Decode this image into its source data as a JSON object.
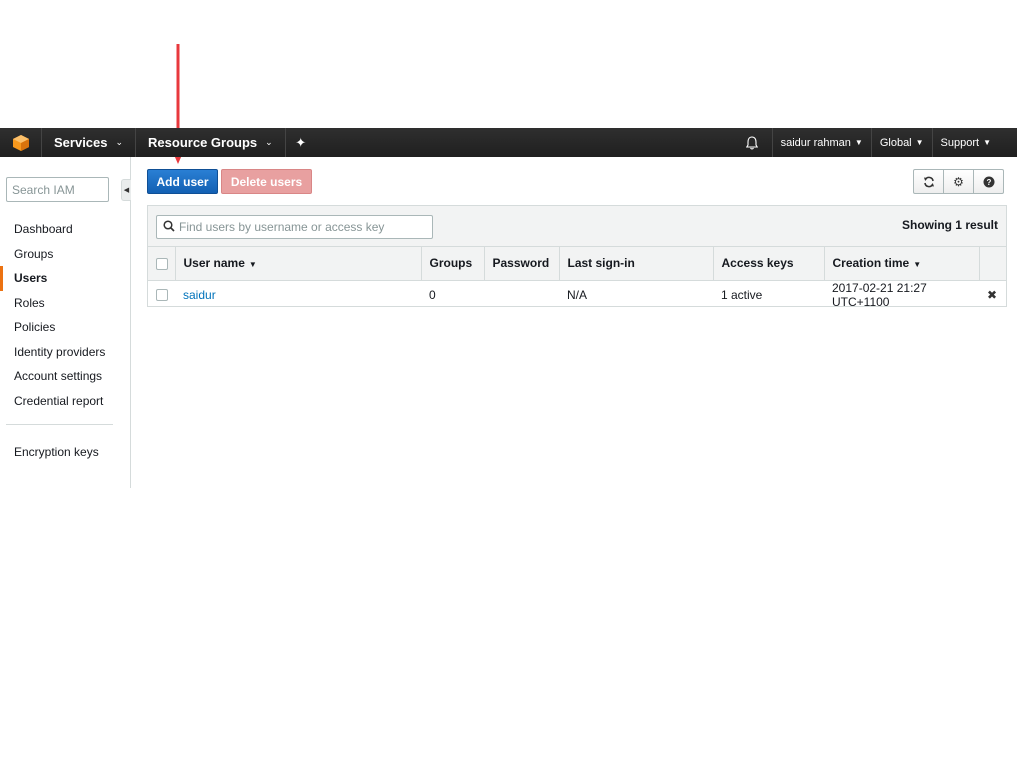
{
  "colors": {
    "nav_bg": "#232f3e",
    "accent_orange": "#ec7211",
    "primary_blue": "#1b6ec2",
    "link_blue": "#0073bb",
    "annotation_red": "#e8383d"
  },
  "topnav": {
    "logo_icon": "aws-cube-icon",
    "services": "Services",
    "resource_groups": "Resource Groups",
    "pin_icon": "pin-icon",
    "bell_icon": "bell-icon",
    "user": "saidur rahman",
    "region": "Global",
    "support": "Support"
  },
  "sidebar": {
    "search_placeholder": "Search IAM",
    "items": [
      {
        "label": "Dashboard"
      },
      {
        "label": "Groups"
      },
      {
        "label": "Users"
      },
      {
        "label": "Roles"
      },
      {
        "label": "Policies"
      },
      {
        "label": "Identity providers"
      },
      {
        "label": "Account settings"
      },
      {
        "label": "Credential report"
      }
    ],
    "secondary_items": [
      {
        "label": "Encryption keys"
      }
    ],
    "active": "Users"
  },
  "toolbar": {
    "add_user": "Add user",
    "delete_users": "Delete users",
    "icons": [
      "refresh-icon",
      "gear-icon",
      "help-icon"
    ]
  },
  "table": {
    "find_placeholder": "Find users by username or access key",
    "showing": "Showing 1 result",
    "columns": [
      "User name",
      "Groups",
      "Password",
      "Last sign-in",
      "Access keys",
      "Creation time"
    ],
    "rows": [
      {
        "user_name": "saidur",
        "groups": "0",
        "password": "",
        "last_sign_in": "N/A",
        "access_keys": "1 active",
        "creation_time": "2017-02-21 21:27 UTC+1100"
      }
    ]
  }
}
